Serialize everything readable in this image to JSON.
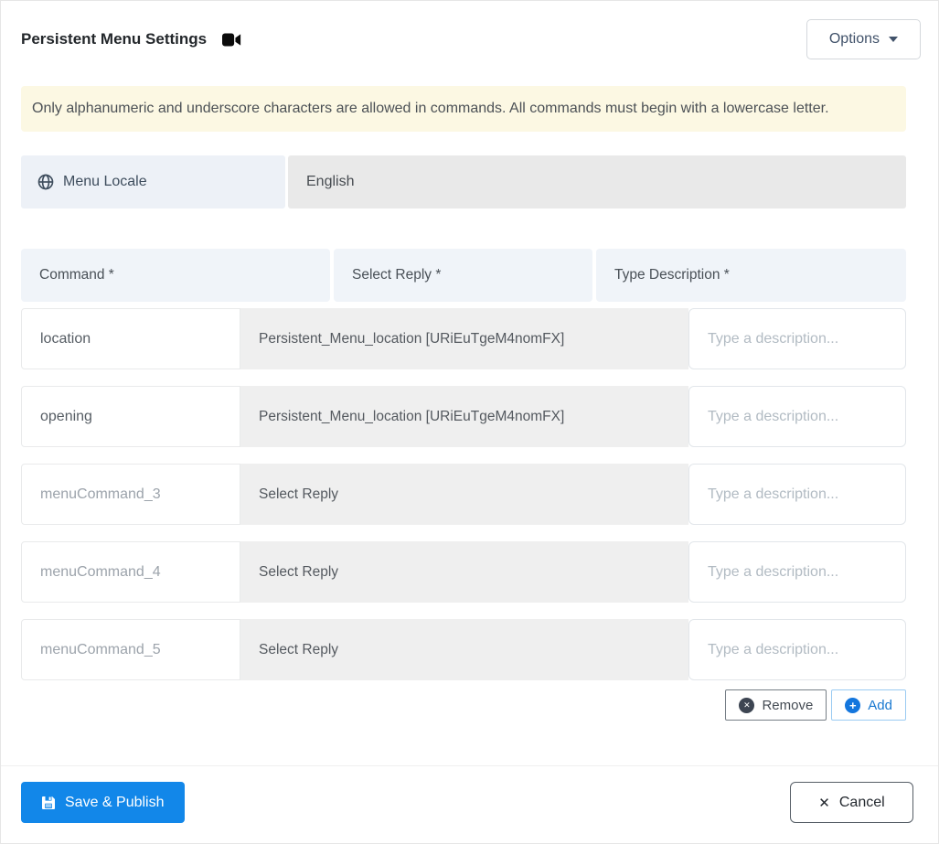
{
  "header": {
    "title": "Persistent Menu Settings",
    "options_label": "Options"
  },
  "alert": {
    "text": "Only alphanumeric and underscore characters are allowed in commands. All commands must begin with a lowercase letter."
  },
  "locale": {
    "label": "Menu Locale",
    "value": "English"
  },
  "table": {
    "headers": {
      "command": "Command *",
      "reply": "Select Reply *",
      "description": "Type Description *"
    },
    "description_placeholder": "Type a description...",
    "rows": [
      {
        "command_value": "location",
        "command_placeholder": "",
        "reply": "Persistent_Menu_location [URiEuTgeM4nomFX]",
        "description_value": ""
      },
      {
        "command_value": "opening",
        "command_placeholder": "",
        "reply": "Persistent_Menu_location [URiEuTgeM4nomFX]",
        "description_value": ""
      },
      {
        "command_value": "",
        "command_placeholder": "menuCommand_3",
        "reply": "Select Reply",
        "description_value": ""
      },
      {
        "command_value": "",
        "command_placeholder": "menuCommand_4",
        "reply": "Select Reply",
        "description_value": ""
      },
      {
        "command_value": "",
        "command_placeholder": "menuCommand_5",
        "reply": "Select Reply",
        "description_value": ""
      }
    ]
  },
  "actions": {
    "remove_label": "Remove",
    "add_label": "Add"
  },
  "footer": {
    "save_label": "Save & Publish",
    "cancel_label": "Cancel"
  },
  "icons": {
    "remove_glyph": "✕",
    "add_glyph": "+",
    "cancel_glyph": "✕"
  },
  "colors": {
    "accent_blue": "#1287e9",
    "add_blue": "#1476dd",
    "alert_bg": "#fcf8e3",
    "locale_label_bg": "#edf1f7",
    "locale_value_bg": "#e9e9e9",
    "table_header_bg": "#f0f4f9",
    "reply_cell_bg": "#efefef",
    "remove_icon_bg": "#3d4552"
  }
}
